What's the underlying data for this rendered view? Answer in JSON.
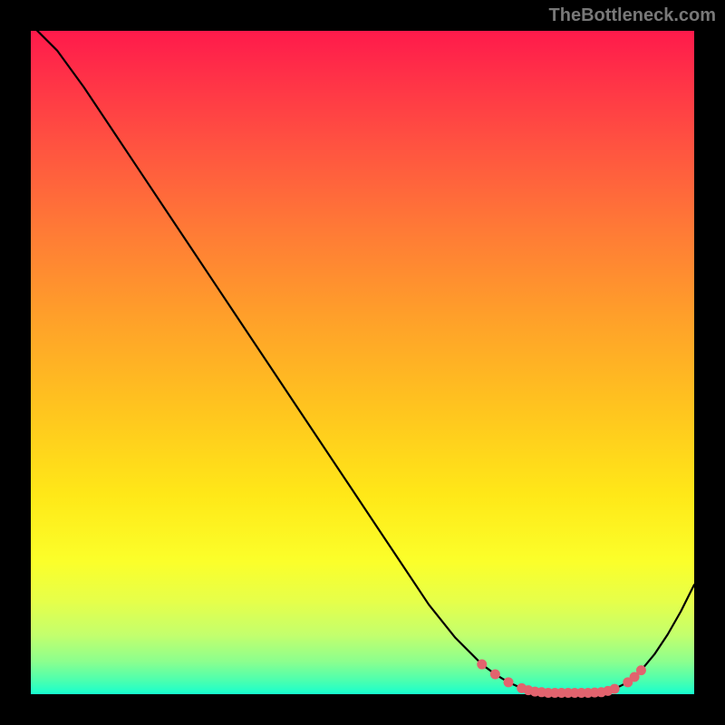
{
  "attribution": "TheBottleneck.com",
  "colors": {
    "marker_fill": "#e2636e",
    "marker_stroke": "#e2636e",
    "curve_stroke": "#000000"
  },
  "chart_data": {
    "type": "line",
    "title": "",
    "xlabel": "",
    "ylabel": "",
    "xlim": [
      0,
      100
    ],
    "ylim": [
      0,
      100
    ],
    "x": [
      0,
      4,
      8,
      12,
      16,
      20,
      24,
      28,
      32,
      36,
      40,
      44,
      48,
      52,
      56,
      60,
      64,
      68,
      70,
      72,
      74,
      76,
      78,
      80,
      82,
      84,
      86,
      88,
      90,
      92,
      94,
      96,
      98,
      100
    ],
    "values": [
      101,
      97,
      91.5,
      85.5,
      79.5,
      73.5,
      67.5,
      61.5,
      55.5,
      49.5,
      43.5,
      37.5,
      31.5,
      25.5,
      19.5,
      13.5,
      8.5,
      4.5,
      3.0,
      1.8,
      0.9,
      0.4,
      0.2,
      0.2,
      0.2,
      0.2,
      0.3,
      0.8,
      1.8,
      3.6,
      6.0,
      9.0,
      12.5,
      16.5
    ],
    "markers_x": [
      68,
      70,
      72,
      74,
      75,
      76,
      77,
      78,
      79,
      80,
      81,
      82,
      83,
      84,
      85,
      86,
      87,
      88,
      90,
      91,
      92
    ],
    "markers_y": [
      4.5,
      3.0,
      1.8,
      0.9,
      0.6,
      0.4,
      0.3,
      0.2,
      0.2,
      0.2,
      0.2,
      0.2,
      0.2,
      0.2,
      0.25,
      0.3,
      0.5,
      0.8,
      1.8,
      2.6,
      3.6
    ]
  }
}
